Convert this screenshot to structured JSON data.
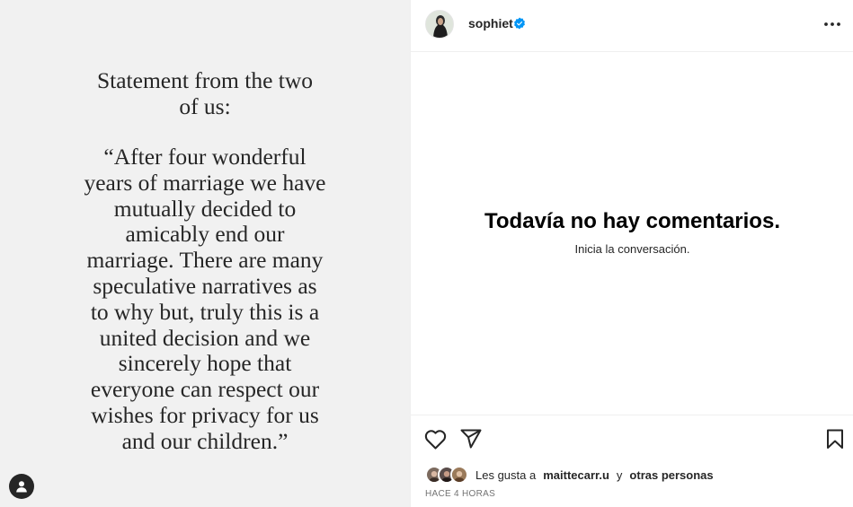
{
  "post": {
    "statement_heading": [
      "Statement from the two",
      "of us:"
    ],
    "statement_quote": [
      "“After four wonderful",
      "years of marriage we have",
      "mutually decided to",
      "amicably end our",
      "marriage. There are many",
      "speculative narratives as",
      "to why but, truly this is a",
      "united decision and we",
      "sincerely hope that",
      "everyone can respect our",
      "wishes for privacy for us",
      "and our children.”"
    ]
  },
  "header": {
    "username": "sophiet",
    "verified_icon": "verified-badge-icon",
    "more_icon": "more-options-icon"
  },
  "comments": {
    "empty_title": "Todavía no hay comentarios.",
    "empty_subtitle": "Inicia la conversación."
  },
  "actions": {
    "like_icon": "heart-icon",
    "share_icon": "send-icon",
    "save_icon": "bookmark-icon"
  },
  "likes": {
    "prefix": "Les gusta a",
    "user": "maittecarr.u",
    "connector": "y",
    "others": "otras personas"
  },
  "timestamp": "HACE 4 HORAS",
  "colors": {
    "verified": "#0095f6",
    "text": "#262626",
    "muted": "#737373",
    "media_bg": "#f1f1f1"
  }
}
